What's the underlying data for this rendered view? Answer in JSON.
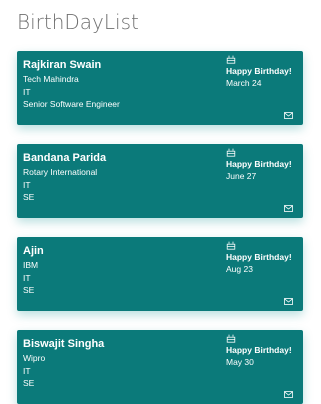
{
  "app": {
    "title": "BirthDayList"
  },
  "colors": {
    "card_background": "#0b7a7a",
    "card_text": "#ffffff",
    "title_text": "#6f6f6f"
  },
  "icons": {
    "card_top": "cake-icon",
    "card_bottom": "mail-icon"
  },
  "cards": [
    {
      "name": "Rajkiran Swain",
      "company": "Tech Mahindra",
      "department": "IT",
      "role": "Senior Software Engineer",
      "greeting": "Happy Birthday!",
      "date": "March 24"
    },
    {
      "name": "Bandana Parida",
      "company": "Rotary International",
      "department": "IT",
      "role": "SE",
      "greeting": "Happy Birthday!",
      "date": "June 27"
    },
    {
      "name": "Ajin",
      "company": "IBM",
      "department": "IT",
      "role": "SE",
      "greeting": "Happy Birthday!",
      "date": "Aug 23"
    },
    {
      "name": "Biswajit Singha",
      "company": "Wipro",
      "department": "IT",
      "role": "SE",
      "greeting": "Happy Birthday!",
      "date": "May 30"
    }
  ]
}
